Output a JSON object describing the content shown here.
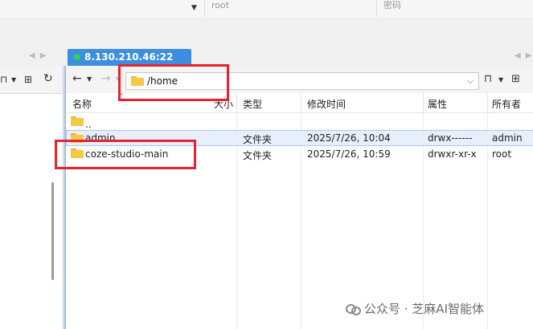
{
  "connection": {
    "user_value": "root",
    "password_placeholder": "密码"
  },
  "tab": {
    "label": "8.130.210.46:22",
    "status_color": "#2fd15a"
  },
  "nav": {
    "path": "/home"
  },
  "columns": {
    "name": "名称",
    "size": "大小",
    "type": "类型",
    "modified": "修改时间",
    "attrs": "属性",
    "owner": "所有者"
  },
  "rows": [
    {
      "name": "..",
      "type": "",
      "modified": "",
      "attrs": "",
      "owner": ""
    },
    {
      "name": "admin",
      "type": "文件夹",
      "modified": "2025/7/26, 10:04",
      "attrs": "drwx------",
      "owner": "admin"
    },
    {
      "name": "coze-studio-main",
      "type": "文件夹",
      "modified": "2025/7/26, 10:59",
      "attrs": "drwxr-xr-x",
      "owner": "root"
    }
  ],
  "watermark": {
    "text": "公众号 · 芝麻AI智能体"
  },
  "colors": {
    "accent": "#3b8ee0",
    "highlight": "#e8222f",
    "folder": "#f6c945"
  },
  "icons": [
    "chevron-down-icon",
    "back-arrow-icon",
    "forward-arrow-icon",
    "folder-icon",
    "bookmark-icon",
    "new-folder-icon",
    "refresh-icon"
  ]
}
